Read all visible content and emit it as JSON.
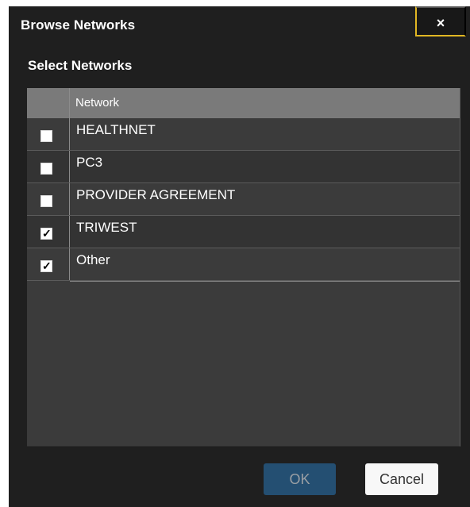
{
  "dialog": {
    "title": "Browse Networks",
    "close_label": "×"
  },
  "section": {
    "title": "Select Networks"
  },
  "table": {
    "columns": [
      "",
      "Network"
    ],
    "rows": [
      {
        "label": "HEALTHNET",
        "checked": false
      },
      {
        "label": "PC3",
        "checked": false
      },
      {
        "label": "PROVIDER AGREEMENT",
        "checked": false
      },
      {
        "label": "TRIWEST",
        "checked": true
      },
      {
        "label": "Other",
        "checked": true
      }
    ]
  },
  "buttons": {
    "ok_label": "OK",
    "cancel_label": "Cancel"
  },
  "colors": {
    "dialog_background": "#1f1f1f",
    "grid_background": "#3b3b3b",
    "header_background": "#7a7a7a",
    "close_accent": "#e1b723",
    "ok_background": "#244f72",
    "cancel_background": "#f8f8f8"
  },
  "icons": {
    "close": "close-icon",
    "checked": "check-icon"
  }
}
